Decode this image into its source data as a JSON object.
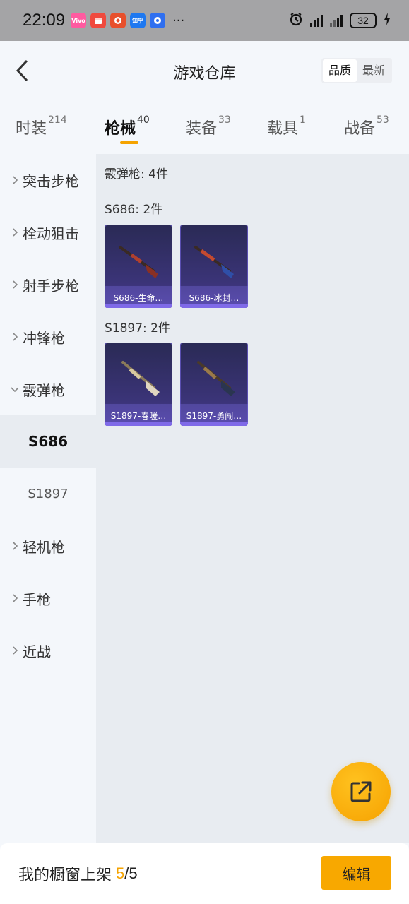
{
  "status_bar": {
    "time": "22:09",
    "apps": [
      {
        "icon": "vivo-app-icon",
        "label": "Vivo",
        "color": "#ff5aa0"
      },
      {
        "icon": "calendar-app-icon",
        "label": "",
        "color": "#f04a3e"
      },
      {
        "icon": "pdd-app-icon",
        "label": "",
        "color": "#e8502c"
      },
      {
        "icon": "zhihu-app-icon",
        "label": "知乎",
        "color": "#1e78f0"
      },
      {
        "icon": "app-store-icon",
        "label": "",
        "color": "#2f6ff0"
      }
    ],
    "more": "···",
    "battery": "32"
  },
  "header": {
    "title": "游戏仓库",
    "sort_options": [
      "品质",
      "最新"
    ],
    "sort_selected": "品质"
  },
  "tabs": [
    {
      "label": "时装",
      "count": "214"
    },
    {
      "label": "枪械",
      "count": "40",
      "active": true
    },
    {
      "label": "装备",
      "count": "33"
    },
    {
      "label": "载具",
      "count": "1"
    },
    {
      "label": "战备",
      "count": "53"
    }
  ],
  "sidebar": {
    "items": [
      {
        "label": "突击步枪",
        "expanded": false
      },
      {
        "label": "栓动狙击",
        "expanded": false
      },
      {
        "label": "射手步枪",
        "expanded": false
      },
      {
        "label": "冲锋枪",
        "expanded": false
      },
      {
        "label": "霰弹枪",
        "expanded": true
      },
      {
        "label": "轻机枪",
        "expanded": false
      },
      {
        "label": "手枪",
        "expanded": false
      },
      {
        "label": "近战",
        "expanded": false
      }
    ],
    "sub_items": [
      {
        "label": "S686",
        "active": true
      },
      {
        "label": "S1897",
        "active": false
      }
    ]
  },
  "content": {
    "category_heading": "霰弹枪: 4件",
    "groups": [
      {
        "heading": "S686: 2件",
        "cards": [
          {
            "label": "S686-生命…",
            "accent": "#b04a3a"
          },
          {
            "label": "S686-冰封…",
            "accent": "#3a5ab0"
          }
        ]
      },
      {
        "heading": "S1897: 2件",
        "cards": [
          {
            "label": "S1897-春暖…",
            "accent": "#c9b48a"
          },
          {
            "label": "S1897-勇闯…",
            "accent": "#8a6a3a"
          }
        ]
      }
    ]
  },
  "bottom_bar": {
    "label": "我的橱窗上架",
    "count_current": "5",
    "count_total": "/5",
    "edit_label": "编辑"
  },
  "colors": {
    "accent": "#f5a300",
    "card_bg": "#2f2c66"
  }
}
